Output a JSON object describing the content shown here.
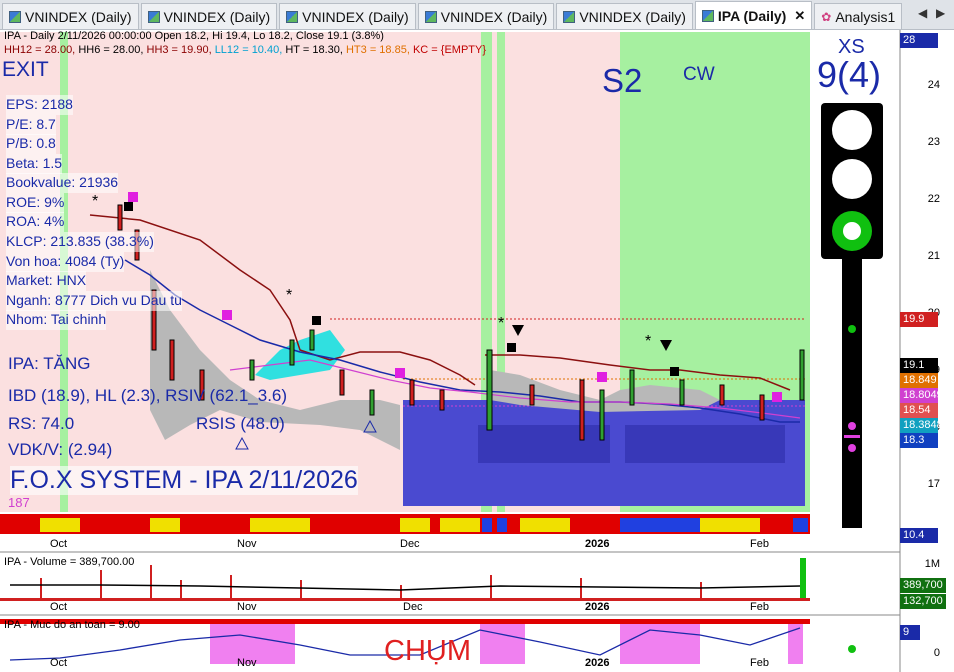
{
  "tabs": [
    {
      "label": "VNINDEX (Daily)",
      "active": false
    },
    {
      "label": "VNINDEX (Daily)",
      "active": false
    },
    {
      "label": "VNINDEX (Daily)",
      "active": false
    },
    {
      "label": "VNINDEX (Daily)",
      "active": false
    },
    {
      "label": "VNINDEX (Daily)",
      "active": false
    },
    {
      "label": "IPA (Daily)",
      "active": true
    },
    {
      "label": "Analysis1",
      "active": false
    }
  ],
  "tab_close": "✕",
  "tab_prev": "◀",
  "tab_next": "▶",
  "header": {
    "line1": "IPA - Daily 2/11/2026 00:00:00 Open 18.2, Hi 19.4, Lo 18.2, Close 19.1 (3.8%)",
    "line2_parts": [
      {
        "text": "HH12 = 28.00, ",
        "color": "#8b0000"
      },
      {
        "text": "HH6 = 28.00, ",
        "color": "#000000"
      },
      {
        "text": "HH3 = 19.90, ",
        "color": "#8b0000"
      },
      {
        "text": "LL12 = 10.40, ",
        "color": "#00a0d0"
      },
      {
        "text": "HT  = 18.30, ",
        "color": "#000000"
      },
      {
        "text": "HT3  = 18.85, ",
        "color": "#e07000"
      },
      {
        "text": "KC = {EMPTY}",
        "color": "#c00000"
      }
    ]
  },
  "labels": {
    "exit": "EXIT",
    "s2": "S2",
    "cw": "CW",
    "xs": "XS",
    "xs_value": "9(4)",
    "chum": "CHỤM",
    "fox": "F.O.X SYSTEM - IPA 2/11/2026",
    "count": "187"
  },
  "fundamentals": [
    "EPS: 2188",
    "P/E: 8.7",
    "P/B: 0.8",
    "Beta: 1.5",
    "Bookvalue: 21936",
    "ROE: 9%",
    "ROA: 4%",
    "KLCP: 213.835 (38.3%)",
    "Von hoa: 4084 (Ty)",
    "Market: HNX",
    "Nganh: 8777 Dich vu Dau tu",
    "Nhom: Tai chinh"
  ],
  "stats": {
    "trend": "IPA: TĂNG",
    "ibd": "IBD (18.9), HL (2.3), RSIV (62.1_3.6)",
    "rs": "RS: 74.0",
    "rsis": "RSIS (48.0)",
    "vdkv": "VDK/V:  (2.94)"
  },
  "price_axis": {
    "top_box": "28",
    "ticks": [
      "24",
      "23",
      "22",
      "21",
      "20",
      "19",
      "18",
      "17"
    ],
    "bottom_box": "10.4"
  },
  "price_tags": [
    {
      "text": "19.9",
      "color": "#d02020"
    },
    {
      "text": "19.1",
      "color": "#000000"
    },
    {
      "text": "18.849",
      "color": "#e07000"
    },
    {
      "text": "18.8049",
      "color": "#d040d0"
    },
    {
      "text": "18.54",
      "color": "#e05050"
    },
    {
      "text": "18.3848",
      "color": "#10a0c0"
    },
    {
      "text": "18.3",
      "color": "#1040c0"
    }
  ],
  "x_axis": [
    "Oct",
    "Nov",
    "Dec",
    "2026",
    "Feb"
  ],
  "volume_panel": {
    "title": "IPA - Volume = 389,700.00",
    "axis_top": "1M",
    "tags": [
      {
        "text": "389,700",
        "color": "#107010"
      },
      {
        "text": "132,700",
        "color": "#107010"
      }
    ]
  },
  "safety_panel": {
    "title": "IPA - Muc do an toan = 9.00",
    "value_tag": "9",
    "axis_zero": "0"
  },
  "colors": {
    "pink_zone": "#fbe0e0",
    "green_zone": "#a6f0a0",
    "blue_box": "#4a4ad0",
    "text_blue": "#1a2aa8",
    "traffic_green": "#10c010"
  }
}
